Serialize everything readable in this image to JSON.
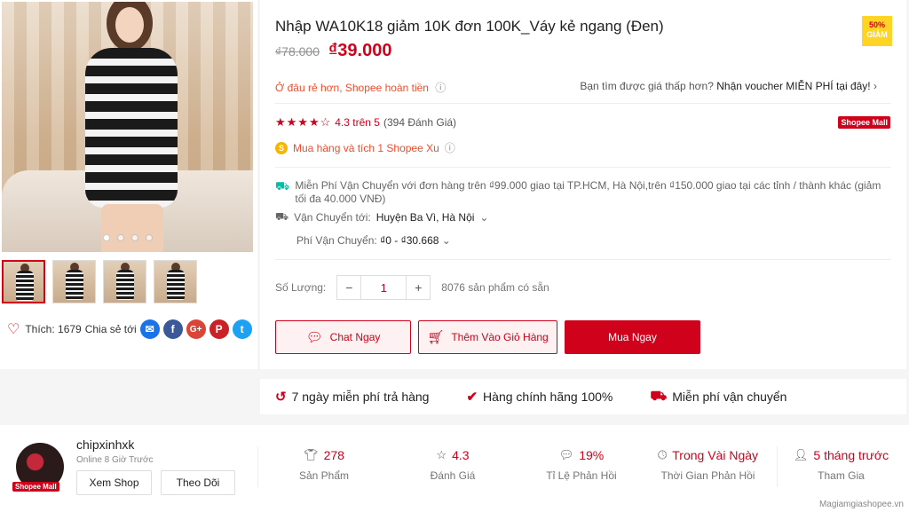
{
  "product": {
    "title": "Nhập WA10K18 giảm 10K đơn 100K_Váy kẻ ngang (Đen)",
    "badge_percent": "50%",
    "badge_label": "GIẢM",
    "old_price": "₫78.000",
    "new_price": "₫39.000",
    "guarantee_text": "Ở đâu rẻ hơn, Shopee hoàn tiền",
    "voucher_prefix": "Bạn tìm được giá thấp hơn?",
    "voucher_link": "Nhận voucher MIỄN PHÍ tại đây!",
    "stars": "★★★★☆",
    "rating_score": "4.3 trên 5",
    "rating_count": "(394 Đánh Giá)",
    "mall_badge": "Shopee Mall",
    "xu_text": "Mua hàng và tích 1 Shopee Xu",
    "shipping_free": "Miễn Phí Vận Chuyển với đơn hàng trên ₫99.000 giao tại TP.HCM, Hà Nội,trên ₫150.000 giao tại các tỉnh / thành khác (giảm tối đa 40.000 VNĐ)",
    "ship_to_label": "Vận Chuyển tới:",
    "ship_to_value": "Huyện Ba Vì, Hà Nội",
    "ship_fee_label": "Phí Vận Chuyển:",
    "ship_fee_value": "₫0 - ₫30.668",
    "qty_label": "Số Lượng:",
    "qty_value": "1",
    "qty_available": "8076 sản phẩm có sẵn",
    "btn_chat": "Chat Ngay",
    "btn_cart": "Thêm Vào Giỏ Hàng",
    "btn_buy": "Mua Ngay"
  },
  "gallery": {
    "likes_label": "Thích: 1679",
    "share_label": "Chia sẻ tới"
  },
  "guarantees": [
    {
      "label": "7 ngày miễn phí trả hàng"
    },
    {
      "label": "Hàng chính hãng 100%"
    },
    {
      "label": "Miễn phí vận chuyển"
    }
  ],
  "shop": {
    "name": "chipxinhxk",
    "online": "Online 8 Giờ Trước",
    "mall_tag": "Shopee Mall",
    "btn_view": "Xem Shop",
    "btn_follow": "Theo Dõi",
    "stats": [
      {
        "value": "278",
        "label": "Sản Phẩm"
      },
      {
        "value": "4.3",
        "label": "Đánh Giá"
      },
      {
        "value": "19%",
        "label": "Tỉ Lệ Phản Hồi"
      },
      {
        "value": "Trong Vài Ngày",
        "label": "Thời Gian Phản Hồi"
      },
      {
        "value": "5 tháng trước",
        "label": "Tham Gia"
      }
    ]
  },
  "watermark": "Magiamgiashopee.vn",
  "colors": {
    "accent": "#d0011b",
    "orange": "#ee4d2d",
    "badge": "#ffd424"
  }
}
